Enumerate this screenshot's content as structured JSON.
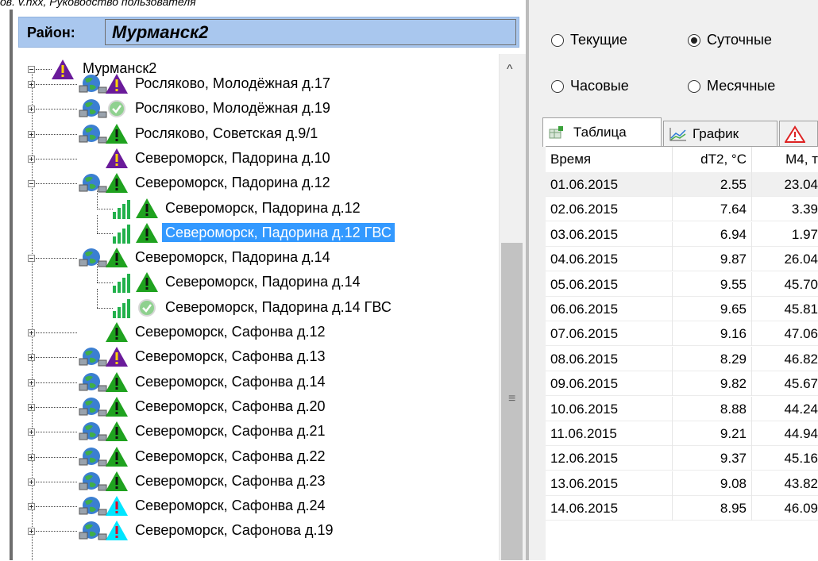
{
  "caption": "ов. v.hxx, Руководство пользователя",
  "district": {
    "label": "Район:",
    "value": "Мурманск2"
  },
  "tree": {
    "root": "Мурманск2",
    "items": [
      {
        "label": "Росляково, Молодёжная д.17",
        "level": 1,
        "expander": "plus",
        "net": true,
        "status": "warn-purple"
      },
      {
        "label": "Росляково, Молодёжная д.19",
        "level": 1,
        "expander": "plus",
        "net": true,
        "status": "ok"
      },
      {
        "label": "Росляково, Советская д.9/1",
        "level": 1,
        "expander": "plus",
        "net": true,
        "status": "warn-green"
      },
      {
        "label": "Североморск, Падорина д.10",
        "level": 1,
        "expander": "plus",
        "net": false,
        "status": "warn-purple"
      },
      {
        "label": "Североморск, Падорина д.12",
        "level": 1,
        "expander": "minus",
        "net": true,
        "status": "warn-green"
      },
      {
        "label": "Североморск, Падорина д.12",
        "level": 2,
        "expander": "none",
        "net": false,
        "signal": true,
        "status": "warn-green"
      },
      {
        "label": "Североморск, Падорина д.12 ГВС",
        "level": 2,
        "expander": "none",
        "net": false,
        "signal": true,
        "status": "warn-green",
        "selected": true
      },
      {
        "label": "Североморск, Падорина д.14",
        "level": 1,
        "expander": "minus",
        "net": true,
        "status": "warn-green"
      },
      {
        "label": "Североморск, Падорина д.14",
        "level": 2,
        "expander": "none",
        "net": false,
        "signal": true,
        "status": "warn-green"
      },
      {
        "label": "Североморск, Падорина д.14 ГВС",
        "level": 2,
        "expander": "none",
        "net": false,
        "signal": true,
        "status": "ok"
      },
      {
        "label": "Североморск, Сафонва д.12",
        "level": 1,
        "expander": "plus",
        "net": false,
        "status": "warn-green"
      },
      {
        "label": "Североморск, Сафонва д.13",
        "level": 1,
        "expander": "plus",
        "net": true,
        "status": "warn-purple"
      },
      {
        "label": "Североморск, Сафонва д.14",
        "level": 1,
        "expander": "plus",
        "net": true,
        "status": "warn-green"
      },
      {
        "label": "Североморск, Сафонва д.20",
        "level": 1,
        "expander": "plus",
        "net": true,
        "status": "warn-green"
      },
      {
        "label": "Североморск, Сафонва д.21",
        "level": 1,
        "expander": "plus",
        "net": true,
        "status": "warn-green"
      },
      {
        "label": "Североморск, Сафонва д.22",
        "level": 1,
        "expander": "plus",
        "net": true,
        "status": "warn-green"
      },
      {
        "label": "Североморск, Сафонва д.23",
        "level": 1,
        "expander": "plus",
        "net": true,
        "status": "warn-green"
      },
      {
        "label": "Североморск, Сафонва д.24",
        "level": 1,
        "expander": "plus",
        "net": true,
        "status": "warn-cyan"
      },
      {
        "label": "Североморск, Сафонова д.19",
        "level": 1,
        "expander": "plus",
        "net": true,
        "status": "warn-cyan"
      }
    ]
  },
  "options": {
    "current": "Текущие",
    "daily": "Суточные",
    "hourly": "Часовые",
    "monthly": "Месячные",
    "selected": "daily"
  },
  "tabs": [
    {
      "label": "Таблица",
      "icon": "table-icon",
      "active": true
    },
    {
      "label": "График",
      "icon": "chart-icon",
      "active": false
    },
    {
      "label": "",
      "icon": "alert-icon",
      "active": false
    }
  ],
  "table": {
    "headers": [
      "Время",
      "dT2, °C",
      "M4, т"
    ],
    "rows": [
      [
        "01.06.2015",
        "2.55",
        "23.04"
      ],
      [
        "02.06.2015",
        "7.64",
        "3.39"
      ],
      [
        "03.06.2015",
        "6.94",
        "1.97"
      ],
      [
        "04.06.2015",
        "9.87",
        "26.04"
      ],
      [
        "05.06.2015",
        "9.55",
        "45.70"
      ],
      [
        "06.06.2015",
        "9.65",
        "45.81"
      ],
      [
        "07.06.2015",
        "9.16",
        "47.06"
      ],
      [
        "08.06.2015",
        "8.29",
        "46.82"
      ],
      [
        "09.06.2015",
        "9.82",
        "45.67"
      ],
      [
        "10.06.2015",
        "8.88",
        "44.24"
      ],
      [
        "11.06.2015",
        "9.21",
        "44.94"
      ],
      [
        "12.06.2015",
        "9.37",
        "45.16"
      ],
      [
        "13.06.2015",
        "9.08",
        "43.82"
      ],
      [
        "14.06.2015",
        "8.95",
        "46.09"
      ]
    ]
  },
  "colors": {
    "selection": "#3399ff",
    "district_bar": "#a9c7ee",
    "warn_green": "#1fa21f",
    "warn_purple": "#6a1b9a",
    "warn_cyan": "#00e5ff",
    "signal": "#22b14c"
  }
}
